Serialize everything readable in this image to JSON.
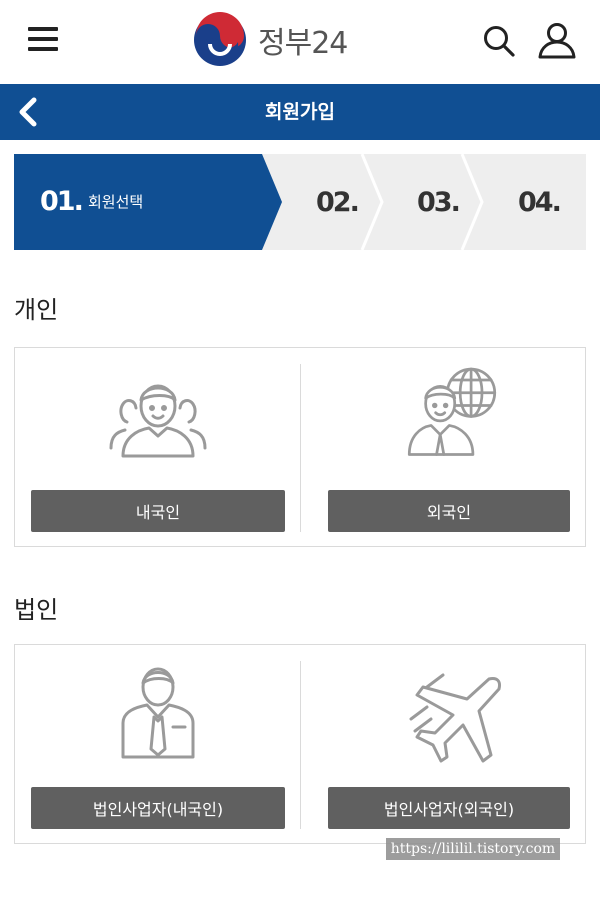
{
  "header": {
    "logo_text": "정부24",
    "menu_icon": "hamburger-menu-icon",
    "search_icon": "search-icon",
    "user_icon": "user-icon"
  },
  "title_bar": {
    "title": "회원가입",
    "back_icon": "chevron-left-icon"
  },
  "stepper": {
    "steps": [
      {
        "number": "01.",
        "label": "회원선택",
        "active": true
      },
      {
        "number": "02.",
        "label": "",
        "active": false
      },
      {
        "number": "03.",
        "label": "",
        "active": false
      },
      {
        "number": "04.",
        "label": "",
        "active": false
      }
    ]
  },
  "sections": [
    {
      "heading": "개인",
      "options": [
        {
          "label": "내국인",
          "icon": "people-group-icon"
        },
        {
          "label": "외국인",
          "icon": "person-globe-icon"
        }
      ]
    },
    {
      "heading": "법인",
      "options": [
        {
          "label": "법인사업자(내국인)",
          "icon": "businessman-icon"
        },
        {
          "label": "법인사업자(외국인)",
          "icon": "airplane-icon"
        }
      ]
    }
  ],
  "watermark": "https://lililil.tistory.com",
  "colors": {
    "primary": "#104f93",
    "button_gray": "#606060",
    "stepper_bg": "#eeeeee",
    "icon_gray": "#9a9a9a"
  }
}
